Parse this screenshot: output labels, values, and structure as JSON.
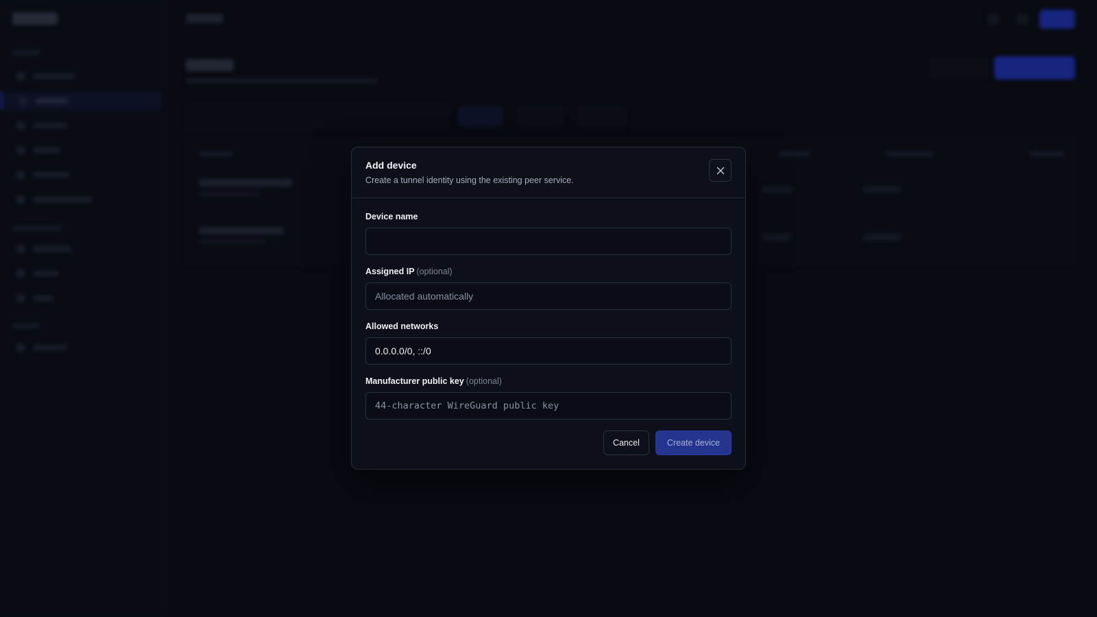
{
  "modal": {
    "title": "Add device",
    "description": "Create a tunnel identity using the existing peer service.",
    "close_icon": "close-icon",
    "fields": {
      "device_name": {
        "label": "Device name",
        "value": "",
        "placeholder": ""
      },
      "assigned_ip": {
        "label": "Assigned IP",
        "optional": "(optional)",
        "value": "",
        "placeholder": "Allocated automatically"
      },
      "allowed_networks": {
        "label": "Allowed networks",
        "value": "0.0.0.0/0, ::/0",
        "placeholder": ""
      },
      "public_key": {
        "label": "Manufacturer public key",
        "optional": "(optional)",
        "value": "",
        "placeholder": "44-character WireGuard public key"
      }
    },
    "actions": {
      "cancel": "Cancel",
      "create": "Create device"
    }
  },
  "colors": {
    "background": "#0b0d15",
    "modal_bg": "#0d1019",
    "primary": "#24348f",
    "accent_blue": "#2437c6"
  }
}
